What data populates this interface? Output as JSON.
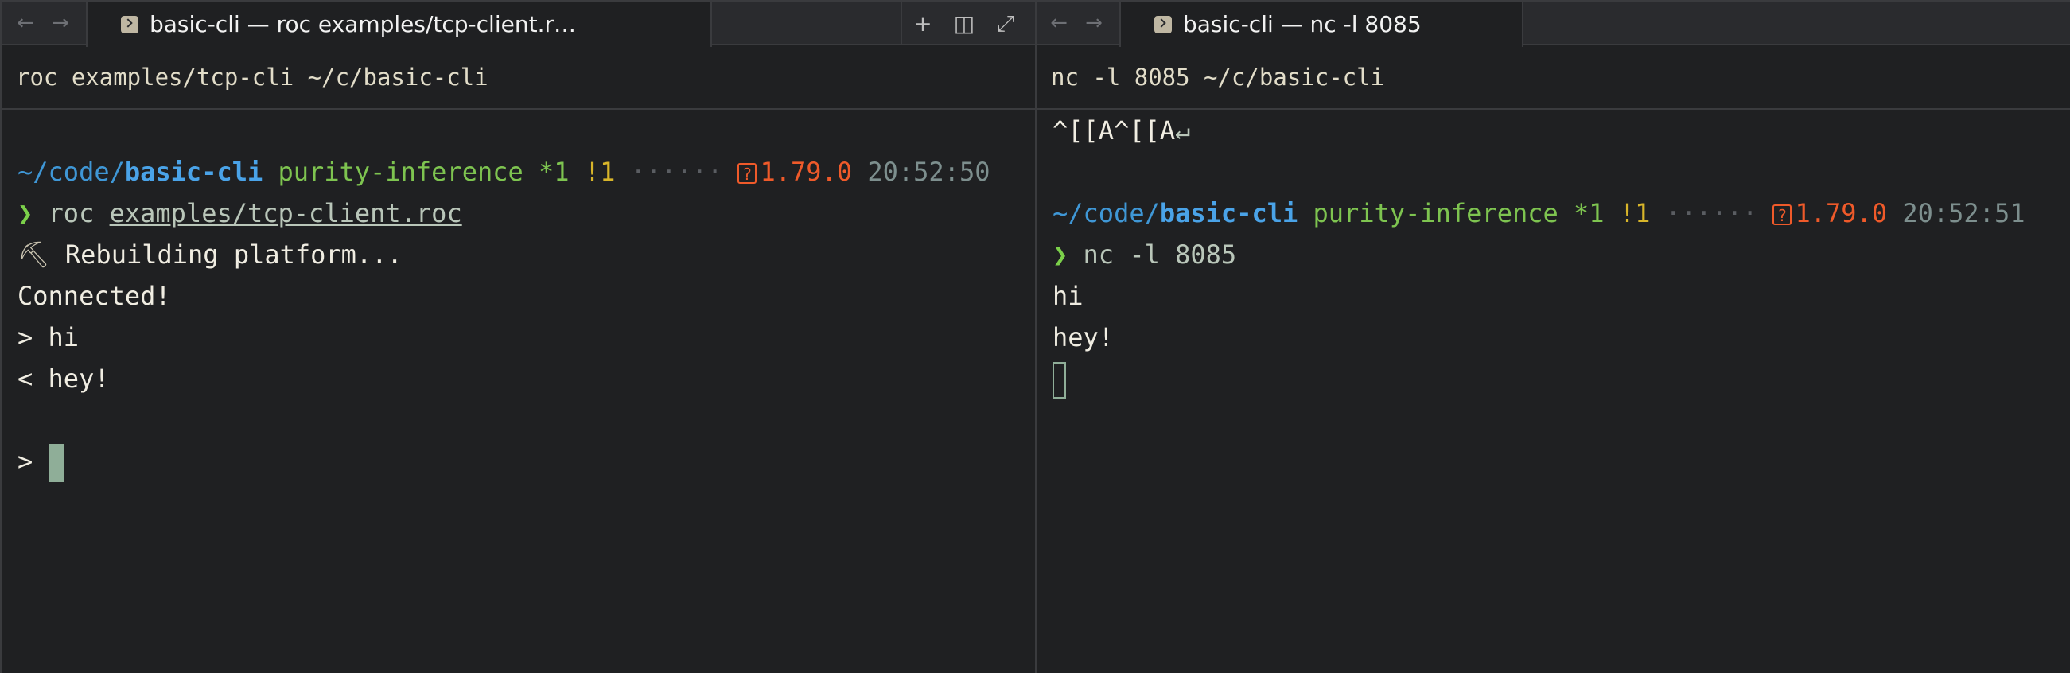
{
  "left_pane": {
    "tab_title": "basic-cli — roc examples/tcp-client.r…",
    "header_text": "roc examples/tcp-cli ~/c/basic-cli",
    "prompt": {
      "path_prefix": "~/code/",
      "dir": "basic-cli",
      "branch": "purity-inference",
      "stash": "*1",
      "modified": "!1",
      "dots": "······",
      "q_icon": "?",
      "version": "1.79.0",
      "time": "20:52:50"
    },
    "command_symbol": "❯",
    "command": "roc",
    "command_arg": "examples/tcp-client.roc",
    "output": {
      "rebuild_icon": "⛏",
      "rebuild": "Rebuilding platform...",
      "connected": "Connected!",
      "sent": "> hi",
      "received": "< hey!",
      "input_prompt": "> "
    }
  },
  "right_pane": {
    "tab_title": "basic-cli — nc -l 8085",
    "header_text": "nc -l 8085 ~/c/basic-cli",
    "pre_line": "^[[A^[[A",
    "return_icon": "↵",
    "prompt": {
      "path_prefix": "~/code/",
      "dir": "basic-cli",
      "branch": "purity-inference",
      "stash": "*1",
      "modified": "!1",
      "dots": "······",
      "q_icon": "?",
      "version": "1.79.0",
      "time": "20:52:51"
    },
    "command_symbol": "❯",
    "command": "nc -l 8085",
    "output": {
      "line1": "hi",
      "line2": "hey!"
    }
  },
  "toolbar": {
    "back_icon": "←",
    "forward_icon": "→",
    "new_tab_icon": "+",
    "split_icon": "◫",
    "expand_icon": "⤢"
  }
}
